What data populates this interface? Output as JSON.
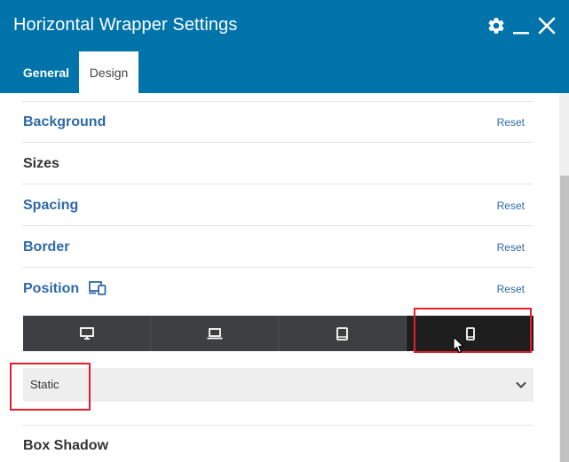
{
  "window": {
    "title": "Horizontal Wrapper Settings",
    "icons": [
      "gear-icon",
      "minimize-icon",
      "close-icon"
    ]
  },
  "tabs": [
    {
      "label": "General",
      "active": false
    },
    {
      "label": "Design",
      "active": true
    }
  ],
  "sections": {
    "background": {
      "title": "Background",
      "reset": "Reset"
    },
    "sizes": {
      "title": "Sizes"
    },
    "spacing": {
      "title": "Spacing",
      "reset": "Reset"
    },
    "border": {
      "title": "Border",
      "reset": "Reset"
    },
    "position": {
      "title": "Position",
      "reset": "Reset",
      "responsive_icon": "responsive-devices-icon",
      "devices": [
        "desktop-icon",
        "laptop-icon",
        "tablet-icon",
        "mobile-icon"
      ],
      "active_device": "mobile",
      "select_value": "Static"
    },
    "box_shadow": {
      "title": "Box Shadow"
    }
  },
  "colors": {
    "header": "#0073aa",
    "link": "#2e6aa8",
    "device_bar": "#3c4043",
    "device_active": "#1e1e1e",
    "highlight": "#e41e2b"
  }
}
